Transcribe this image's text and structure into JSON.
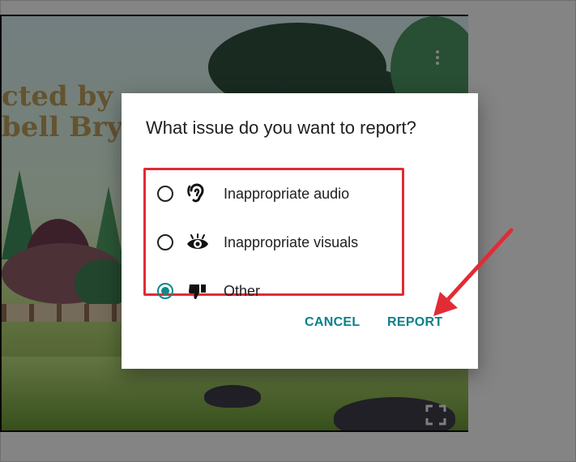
{
  "player": {
    "credit_line1": "cted by",
    "credit_line2": "bell Bryer"
  },
  "dialog": {
    "title": "What issue do you want to report?",
    "options": [
      {
        "label": "Inappropriate audio",
        "icon": "ear-icon",
        "selected": false
      },
      {
        "label": "Inappropriate visuals",
        "icon": "eye-icon",
        "selected": false
      },
      {
        "label": "Other",
        "icon": "thumbs-down-icon",
        "selected": true
      }
    ],
    "cancel_label": "CANCEL",
    "report_label": "REPORT"
  },
  "colors": {
    "accent": "#0b8a8a",
    "highlight": "#e22b35",
    "annotation_arrow": "#e22b35"
  }
}
